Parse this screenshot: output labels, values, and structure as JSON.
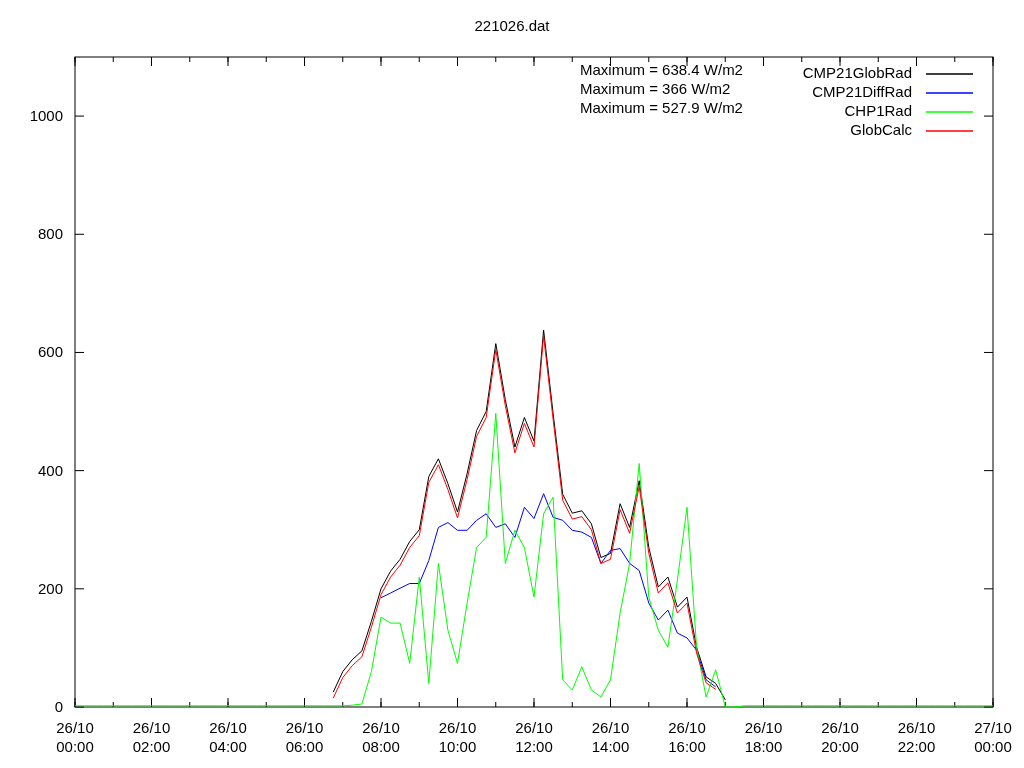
{
  "chart_data": {
    "type": "line",
    "title": "221026.dat",
    "ylim": [
      0,
      1100
    ],
    "categories": [
      "26/10 00:00",
      null,
      null,
      null,
      null,
      null,
      null,
      null,
      "26/10 02:00",
      null,
      null,
      null,
      null,
      null,
      null,
      null,
      "26/10 04:00",
      null,
      null,
      null,
      null,
      null,
      null,
      null,
      "26/10 06:00",
      null,
      null,
      null,
      null,
      null,
      null,
      null,
      "26/10 08:00",
      null,
      null,
      null,
      null,
      null,
      null,
      null,
      "26/10 10:00",
      null,
      null,
      null,
      null,
      null,
      null,
      null,
      "26/10 12:00",
      null,
      null,
      null,
      null,
      null,
      null,
      null,
      "26/10 14:00",
      null,
      null,
      null,
      null,
      null,
      null,
      null,
      "26/10 16:00",
      null,
      null,
      null,
      null,
      null,
      null,
      null,
      "26/10 18:00",
      null,
      null,
      null,
      null,
      null,
      null,
      null,
      "26/10 20:00",
      null,
      null,
      null,
      null,
      null,
      null,
      null,
      "26/10 22:00",
      null,
      null,
      null,
      null,
      null,
      null,
      null,
      "27/10 00:00"
    ],
    "yticks": [
      0,
      200,
      400,
      600,
      800,
      1000
    ],
    "series": [
      {
        "name": "CMP21GlobRad",
        "color": "#000000",
        "values": [
          null,
          null,
          null,
          null,
          null,
          null,
          null,
          null,
          null,
          null,
          null,
          null,
          null,
          null,
          null,
          null,
          null,
          null,
          null,
          null,
          null,
          null,
          null,
          null,
          null,
          null,
          null,
          25,
          60,
          80,
          95,
          145,
          200,
          230,
          250,
          280,
          300,
          390,
          420,
          378,
          330,
          395,
          468,
          500,
          615,
          520,
          440,
          490,
          450,
          638,
          497,
          360,
          328,
          332,
          310,
          253,
          260,
          344,
          304,
          383,
          270,
          203,
          220,
          169,
          186,
          101,
          51,
          40,
          12,
          null,
          null,
          null,
          null,
          null,
          null,
          null,
          null,
          null,
          null,
          null,
          null,
          null,
          null,
          null,
          null,
          null,
          null,
          null,
          null,
          null,
          null,
          null,
          null,
          null,
          null,
          null,
          null
        ]
      },
      {
        "name": "CMP21DiffRad",
        "color": "#0000ff",
        "values": [
          null,
          null,
          null,
          null,
          null,
          null,
          null,
          null,
          null,
          null,
          null,
          null,
          null,
          null,
          null,
          null,
          null,
          null,
          null,
          null,
          null,
          null,
          null,
          null,
          null,
          null,
          null,
          null,
          null,
          null,
          null,
          null,
          185,
          193,
          201,
          209,
          209,
          248,
          304,
          312,
          299,
          299,
          316,
          327,
          304,
          310,
          287,
          338,
          319,
          361,
          321,
          316,
          299,
          296,
          287,
          243,
          265,
          268,
          243,
          231,
          176,
          147,
          164,
          125,
          117,
          96,
          46,
          34,
          null,
          null,
          null,
          null,
          null,
          null,
          null,
          null,
          null,
          null,
          null,
          null,
          null,
          null,
          null,
          null,
          null,
          null,
          null,
          null,
          null,
          null,
          null,
          null,
          null,
          null,
          null,
          null,
          null
        ]
      },
      {
        "name": "CHP1Rad",
        "color": "#00ff00",
        "values": [
          2,
          2,
          2,
          2,
          2,
          2,
          2,
          2,
          2,
          2,
          2,
          2,
          2,
          2,
          2,
          2,
          2,
          2,
          2,
          2,
          2,
          2,
          2,
          2,
          2,
          2,
          2,
          2,
          2,
          3,
          5,
          60,
          152,
          142,
          142,
          74,
          220,
          40,
          243,
          130,
          74,
          176,
          270,
          287,
          497,
          243,
          299,
          270,
          186,
          327,
          355,
          46,
          29,
          68,
          29,
          17,
          46,
          159,
          243,
          412,
          186,
          130,
          101,
          215,
          338,
          101,
          17,
          63,
          0,
          0,
          2,
          2,
          2,
          2,
          2,
          2,
          2,
          2,
          2,
          2,
          2,
          2,
          2,
          2,
          2,
          2,
          2,
          2,
          2,
          2,
          2,
          2,
          2,
          2,
          2,
          2,
          2
        ]
      },
      {
        "name": "GlobCalc",
        "color": "#ff0000",
        "values": [
          null,
          null,
          null,
          null,
          null,
          null,
          null,
          null,
          null,
          null,
          null,
          null,
          null,
          null,
          null,
          null,
          null,
          null,
          null,
          null,
          null,
          null,
          null,
          null,
          null,
          null,
          null,
          15,
          50,
          70,
          85,
          135,
          190,
          220,
          240,
          270,
          290,
          380,
          410,
          368,
          320,
          385,
          458,
          490,
          605,
          510,
          430,
          480,
          440,
          628,
          487,
          350,
          318,
          322,
          300,
          243,
          250,
          334,
          294,
          373,
          260,
          193,
          210,
          159,
          176,
          91,
          41,
          30,
          null,
          null,
          null,
          null,
          null,
          null,
          null,
          null,
          null,
          null,
          null,
          null,
          null,
          null,
          null,
          null,
          null,
          null,
          null,
          null,
          null,
          null,
          null,
          null,
          null,
          null,
          null,
          null,
          null
        ]
      }
    ],
    "legend": true,
    "annotations": [
      {
        "text": "Maximum = 638.4 W/m2"
      },
      {
        "text": "Maximum = 366 W/m2"
      },
      {
        "text": "Maximum = 527.9 W/m2"
      }
    ]
  }
}
